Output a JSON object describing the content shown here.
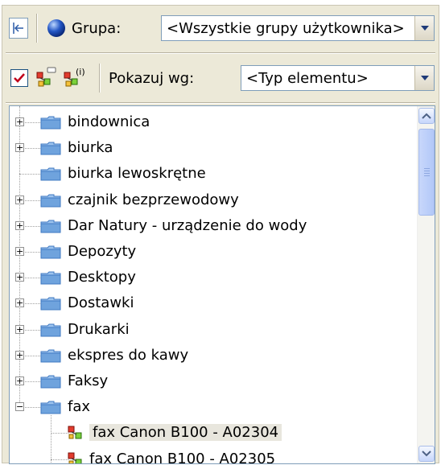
{
  "toolbar1": {
    "group_label": "Grupa:",
    "group_value": "<Wszystkie grupy użytkownika>"
  },
  "toolbar2": {
    "show_by_label": "Pokazuj wg:",
    "show_by_value": "<Typ elementu>",
    "icon2_superscript": "(i)"
  },
  "tree": {
    "items": [
      {
        "label": "bindownica",
        "expander": "+"
      },
      {
        "label": "biurka",
        "expander": "+"
      },
      {
        "label": "biurka lewoskrętne",
        "expander": ""
      },
      {
        "label": "czajnik bezprzewodowy",
        "expander": "+"
      },
      {
        "label": "Dar Natury - urządzenie do wody",
        "expander": "+"
      },
      {
        "label": "Depozyty",
        "expander": "+"
      },
      {
        "label": "Desktopy",
        "expander": "+"
      },
      {
        "label": "Dostawki",
        "expander": "+"
      },
      {
        "label": "Drukarki",
        "expander": "+"
      },
      {
        "label": "ekspres do kawy",
        "expander": "+"
      },
      {
        "label": "Faksy",
        "expander": "+"
      },
      {
        "label": "fax",
        "expander": "−"
      }
    ],
    "children": [
      {
        "label": "fax Canon B100 - A02304"
      },
      {
        "label": "fax Canon B100 - A02305"
      }
    ]
  },
  "colors": {
    "panel_bg": "#ece9d8",
    "folder": "#6fa3dd",
    "checkbox": "#c0001a",
    "combo_arrow": "#1f3b79"
  },
  "icons": {
    "back": "back-arrow-icon",
    "globe": "globe-icon",
    "checkbox": "checkbox-icon",
    "elements": "network-nodes-icon",
    "elements_info": "network-nodes-info-icon",
    "folder": "folder-icon",
    "item": "element-node-icon"
  }
}
